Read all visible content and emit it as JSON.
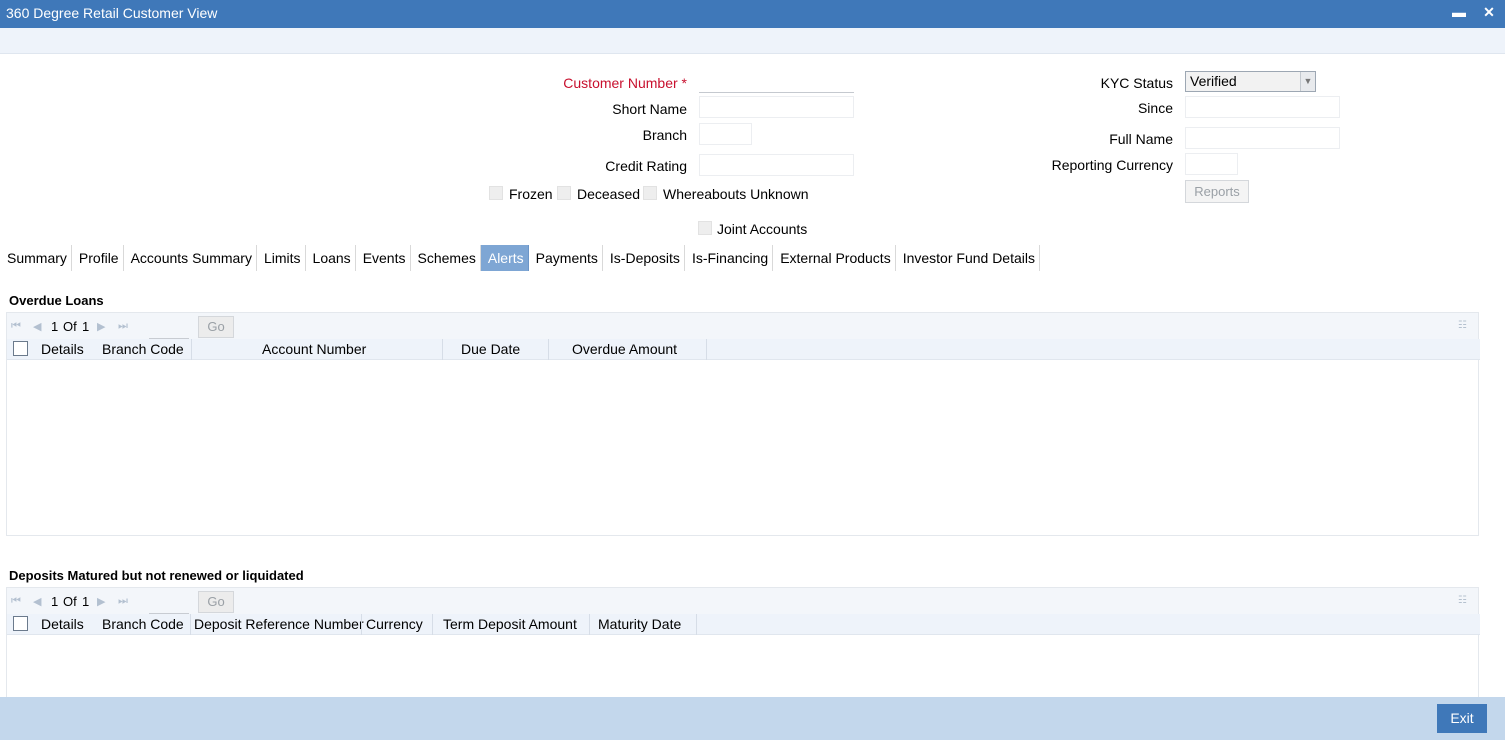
{
  "window": {
    "title": "360 Degree Retail Customer View",
    "minimize_icon": "minimize-icon",
    "close_icon": "close-icon"
  },
  "form": {
    "customer_number": {
      "label": "Customer Number",
      "required_mark": "*",
      "value": ""
    },
    "short_name": {
      "label": "Short Name",
      "value": ""
    },
    "branch": {
      "label": "Branch",
      "value": ""
    },
    "credit_rating": {
      "label": "Credit Rating",
      "value": ""
    },
    "kyc_status": {
      "label": "KYC Status",
      "value": "Verified"
    },
    "since": {
      "label": "Since",
      "value": ""
    },
    "full_name": {
      "label": "Full Name",
      "value": ""
    },
    "reporting_currency": {
      "label": "Reporting Currency",
      "value": ""
    },
    "flags": [
      "Frozen",
      "Deceased",
      "Whereabouts Unknown"
    ],
    "joint_accounts": "Joint Accounts",
    "reports_button": "Reports"
  },
  "tabs": [
    {
      "label": "Summary",
      "active": false
    },
    {
      "label": "Profile",
      "active": false
    },
    {
      "label": "Accounts Summary",
      "active": false
    },
    {
      "label": "Limits",
      "active": false
    },
    {
      "label": "Loans",
      "active": false
    },
    {
      "label": "Events",
      "active": false
    },
    {
      "label": "Schemes",
      "active": false
    },
    {
      "label": "Alerts",
      "active": true
    },
    {
      "label": "Payments",
      "active": false
    },
    {
      "label": "Is-Deposits",
      "active": false
    },
    {
      "label": "Is-Financing",
      "active": false
    },
    {
      "label": "External Products",
      "active": false
    },
    {
      "label": "Investor Fund Details",
      "active": false
    }
  ],
  "overdue_loans": {
    "title": "Overdue Loans",
    "pager": {
      "current": "1",
      "of": "Of",
      "total": "1",
      "go": "Go"
    },
    "columns": [
      "Details",
      "Branch Code",
      "Account Number",
      "Due Date",
      "Overdue Amount"
    ],
    "rows": []
  },
  "matured_deposits": {
    "title": "Deposits Matured but not renewed or liquidated",
    "pager": {
      "current": "1",
      "of": "Of",
      "total": "1",
      "go": "Go"
    },
    "columns": [
      "Details",
      "Branch Code",
      "Deposit Reference Number",
      "Currency",
      "Term Deposit Amount",
      "Maturity Date"
    ],
    "rows": []
  },
  "footer": {
    "exit_label": "Exit"
  },
  "colors": {
    "title_bar": "#3f78b9",
    "active_tab": "#7ea6d4",
    "required": "#c8102e",
    "footer": "#c3d7ec"
  }
}
